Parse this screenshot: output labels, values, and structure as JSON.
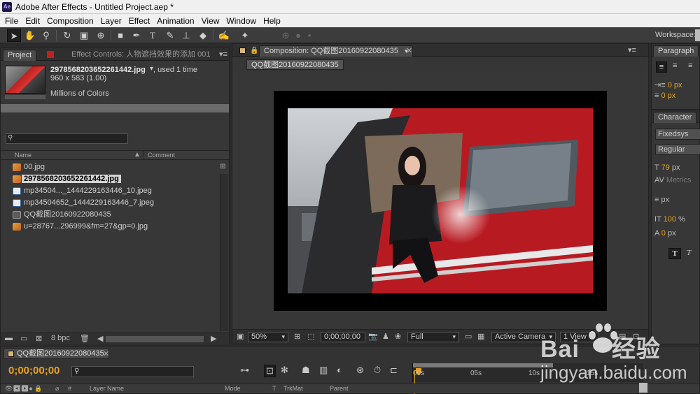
{
  "window": {
    "app_icon": "Ae",
    "title": "Adobe After Effects - Untitled Project.aep *"
  },
  "menu": [
    "File",
    "Edit",
    "Composition",
    "Layer",
    "Effect",
    "Animation",
    "View",
    "Window",
    "Help"
  ],
  "toolbar": {
    "workspace_label": "Workspace:",
    "tools": [
      "selection-tool-icon",
      "hand-tool-icon",
      "zoom-tool-icon",
      "rotate-tool-icon",
      "camera-tool-icon",
      "pan-behind-tool-icon",
      "rectangle-tool-icon",
      "pen-tool-icon",
      "type-tool-icon",
      "brush-tool-icon",
      "clone-stamp-tool-icon",
      "eraser-tool-icon",
      "roto-brush-tool-icon",
      "puppet-pin-tool-icon"
    ]
  },
  "project_panel": {
    "tab_project": "Project",
    "tab_effect_controls": "Effect Controls: 人物遮挡效果的添加 001",
    "selected_file": {
      "name": "2978568203652261442.jpg",
      "used": ", used 1 time",
      "dims": "960 x 583 (1.00)",
      "colors": "Millions of Colors"
    },
    "search_placeholder": "",
    "columns": {
      "name": "Name",
      "comment": "Comment"
    },
    "files": [
      {
        "name": "00.jpg",
        "type": "img",
        "selected": false
      },
      {
        "name": "2978568203652261442.jpg",
        "type": "img",
        "selected": true
      },
      {
        "name": "mp34504..._1444229163446_10.jpeg",
        "type": "doc",
        "selected": false
      },
      {
        "name": "mp34504652_1444229163446_7.jpeg",
        "type": "doc",
        "selected": false
      },
      {
        "name": "QQ截图20160922080435",
        "type": "comp",
        "selected": false
      },
      {
        "name": "u=28767...296999&fm=27&gp=0.jpg",
        "type": "img",
        "selected": false
      }
    ],
    "footer": {
      "bpc": "8 bpc"
    }
  },
  "comp_panel": {
    "tab": "Composition: QQ截图20160922080435",
    "subtab": "QQ截图20160922080435",
    "footer": {
      "zoom": "50%",
      "timecode": "0;00;00;00",
      "resolution": "Full",
      "camera": "Active Camera",
      "views": "1 View"
    }
  },
  "paragraph_panel": {
    "title": "Paragraph",
    "indent1": "0 px",
    "indent2": "0 px"
  },
  "character_panel": {
    "title": "Character",
    "font": "Fixedsys",
    "style": "Regular",
    "size": "79",
    "size_unit": "px",
    "tracking": "Metrics",
    "leading_unit": "px",
    "scale": "100",
    "scale_unit": "%",
    "baseline": "0",
    "baseline_unit": "px"
  },
  "timeline": {
    "tab": "QQ截图20160922080435",
    "timecode": "0;00;00;00",
    "ruler": [
      "00s",
      "05s",
      "10s",
      "15s"
    ],
    "columns": {
      "hash": "#",
      "layer_name": "Layer Name",
      "mode": "Mode",
      "t": "T",
      "trkmat": "TrkMat",
      "parent": "Parent"
    }
  },
  "watermark": {
    "main": "Bai",
    "main2": "经验",
    "sub": "jingyan.baidu.com"
  },
  "colors": {
    "accent": "#e6a21f",
    "panel": "#373737",
    "header": "#2f2f2f"
  }
}
